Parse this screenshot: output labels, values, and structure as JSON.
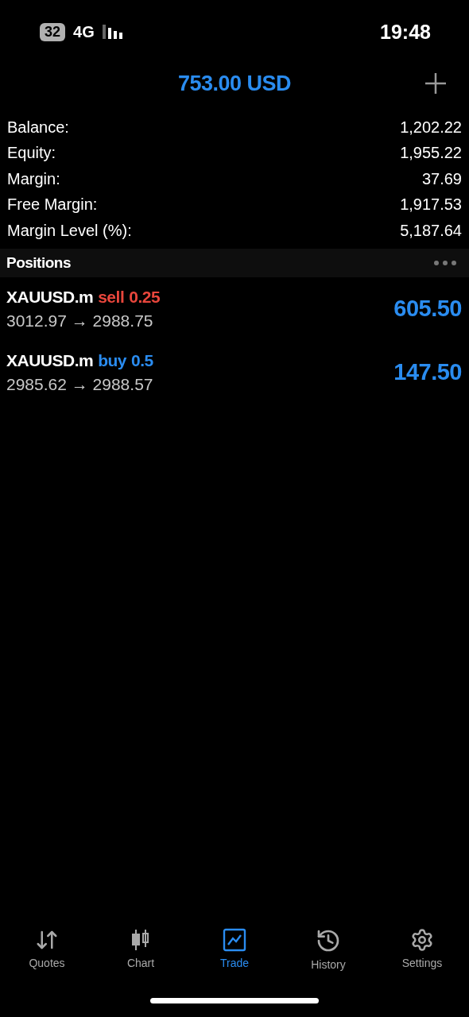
{
  "status_bar": {
    "battery": "32",
    "network": "4G",
    "time": "19:48"
  },
  "header": {
    "title": "753.00 USD"
  },
  "summary": [
    {
      "label": "Balance:",
      "value": "1,202.22"
    },
    {
      "label": "Equity:",
      "value": "1,955.22"
    },
    {
      "label": "Margin:",
      "value": "37.69"
    },
    {
      "label": "Free Margin:",
      "value": "1,917.53"
    },
    {
      "label": "Margin Level (%):",
      "value": "5,187.64"
    }
  ],
  "positions_header": {
    "title": "Positions"
  },
  "positions": [
    {
      "symbol": "XAUUSD.m",
      "side": "sell",
      "lots": "0.25",
      "prices": "3012.97 → 2988.75",
      "profit": "605.50"
    },
    {
      "symbol": "XAUUSD.m",
      "side": "buy",
      "lots": "0.5",
      "prices": "2985.62 → 2988.57",
      "profit": "147.50"
    }
  ],
  "tabs": [
    {
      "label": "Quotes",
      "kind": "quotes",
      "selected": false
    },
    {
      "label": "Chart",
      "kind": "chart",
      "selected": false
    },
    {
      "label": "Trade",
      "kind": "trade",
      "selected": true
    },
    {
      "label": "History",
      "kind": "history",
      "selected": false
    },
    {
      "label": "Settings",
      "kind": "settings",
      "selected": false
    }
  ]
}
